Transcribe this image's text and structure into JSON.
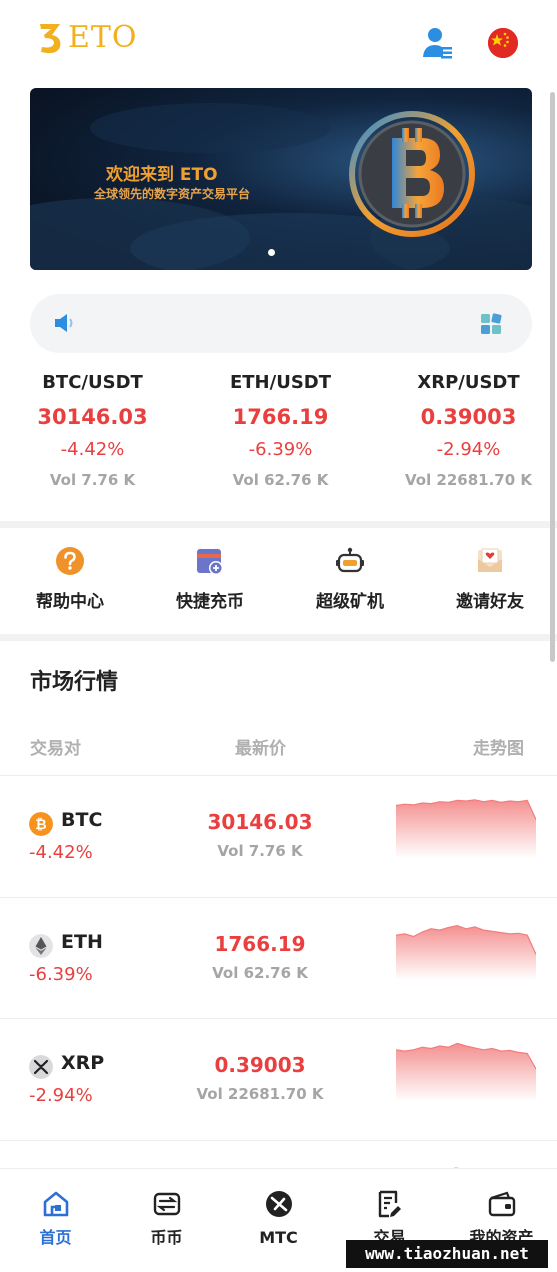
{
  "header": {
    "logo_text": "ETO",
    "user_icon": "user-list-icon",
    "language_flag": "china-flag-icon"
  },
  "banner": {
    "title": "欢迎来到 ETO",
    "subtitle": "全球领先的数字资产交易平台",
    "image": "bitcoin-coin-art",
    "slide_count": 1
  },
  "notice": {
    "speaker_icon": "speaker-icon",
    "grid_icon": "grid-icon"
  },
  "tickers": [
    {
      "pair": "BTC/USDT",
      "price": "30146.03",
      "change": "-4.42%",
      "volume": "Vol 7.76 K"
    },
    {
      "pair": "ETH/USDT",
      "price": "1766.19",
      "change": "-6.39%",
      "volume": "Vol 62.76 K"
    },
    {
      "pair": "XRP/USDT",
      "price": "0.39003",
      "change": "-2.94%",
      "volume": "Vol 22681.70 K"
    }
  ],
  "quick_actions": [
    {
      "label": "帮助中心",
      "icon": "help-icon"
    },
    {
      "label": "快捷充币",
      "icon": "deposit-card-icon"
    },
    {
      "label": "超级矿机",
      "icon": "robot-miner-icon"
    },
    {
      "label": "邀请好友",
      "icon": "invite-envelope-icon"
    }
  ],
  "market": {
    "title": "市场行情",
    "columns": {
      "pair": "交易对",
      "price": "最新价",
      "trend": "走势图"
    },
    "rows": [
      {
        "symbol": "BTC",
        "change": "-4.42%",
        "price": "30146.03",
        "volume": "Vol 7.76 K",
        "icon": "btc-icon",
        "trend": [
          0.82,
          0.84,
          0.83,
          0.86,
          0.85,
          0.88,
          0.87,
          0.9,
          0.89,
          0.91,
          0.88,
          0.9,
          0.87,
          0.89,
          0.88,
          0.9,
          0.6
        ]
      },
      {
        "symbol": "ETH",
        "change": "-6.39%",
        "price": "1766.19",
        "volume": "Vol 62.76 K",
        "icon": "eth-icon",
        "trend": [
          0.7,
          0.72,
          0.68,
          0.75,
          0.8,
          0.78,
          0.82,
          0.85,
          0.8,
          0.83,
          0.78,
          0.76,
          0.74,
          0.72,
          0.73,
          0.7,
          0.4
        ]
      },
      {
        "symbol": "XRP",
        "change": "-2.94%",
        "price": "0.39003",
        "volume": "Vol 22681.70 K",
        "icon": "xrp-icon",
        "trend": [
          0.8,
          0.78,
          0.8,
          0.84,
          0.82,
          0.86,
          0.84,
          0.9,
          0.86,
          0.83,
          0.8,
          0.82,
          0.78,
          0.79,
          0.76,
          0.74,
          0.5
        ]
      }
    ]
  },
  "tabbar": [
    {
      "label": "首页",
      "icon": "home-icon",
      "active": true
    },
    {
      "label": "币币",
      "icon": "exchange-icon",
      "active": false
    },
    {
      "label": "MTC",
      "icon": "mtc-coin-icon",
      "active": false
    },
    {
      "label": "交易",
      "icon": "trade-document-icon",
      "active": false
    },
    {
      "label": "我的资产",
      "icon": "wallet-icon",
      "active": false
    }
  ],
  "watermark": "www.tiaozhuan.net",
  "colors": {
    "down": "#ea3f3f",
    "accent": "#2c6fd6",
    "logo": "#f2b01e",
    "muted": "#a5a5a5"
  }
}
